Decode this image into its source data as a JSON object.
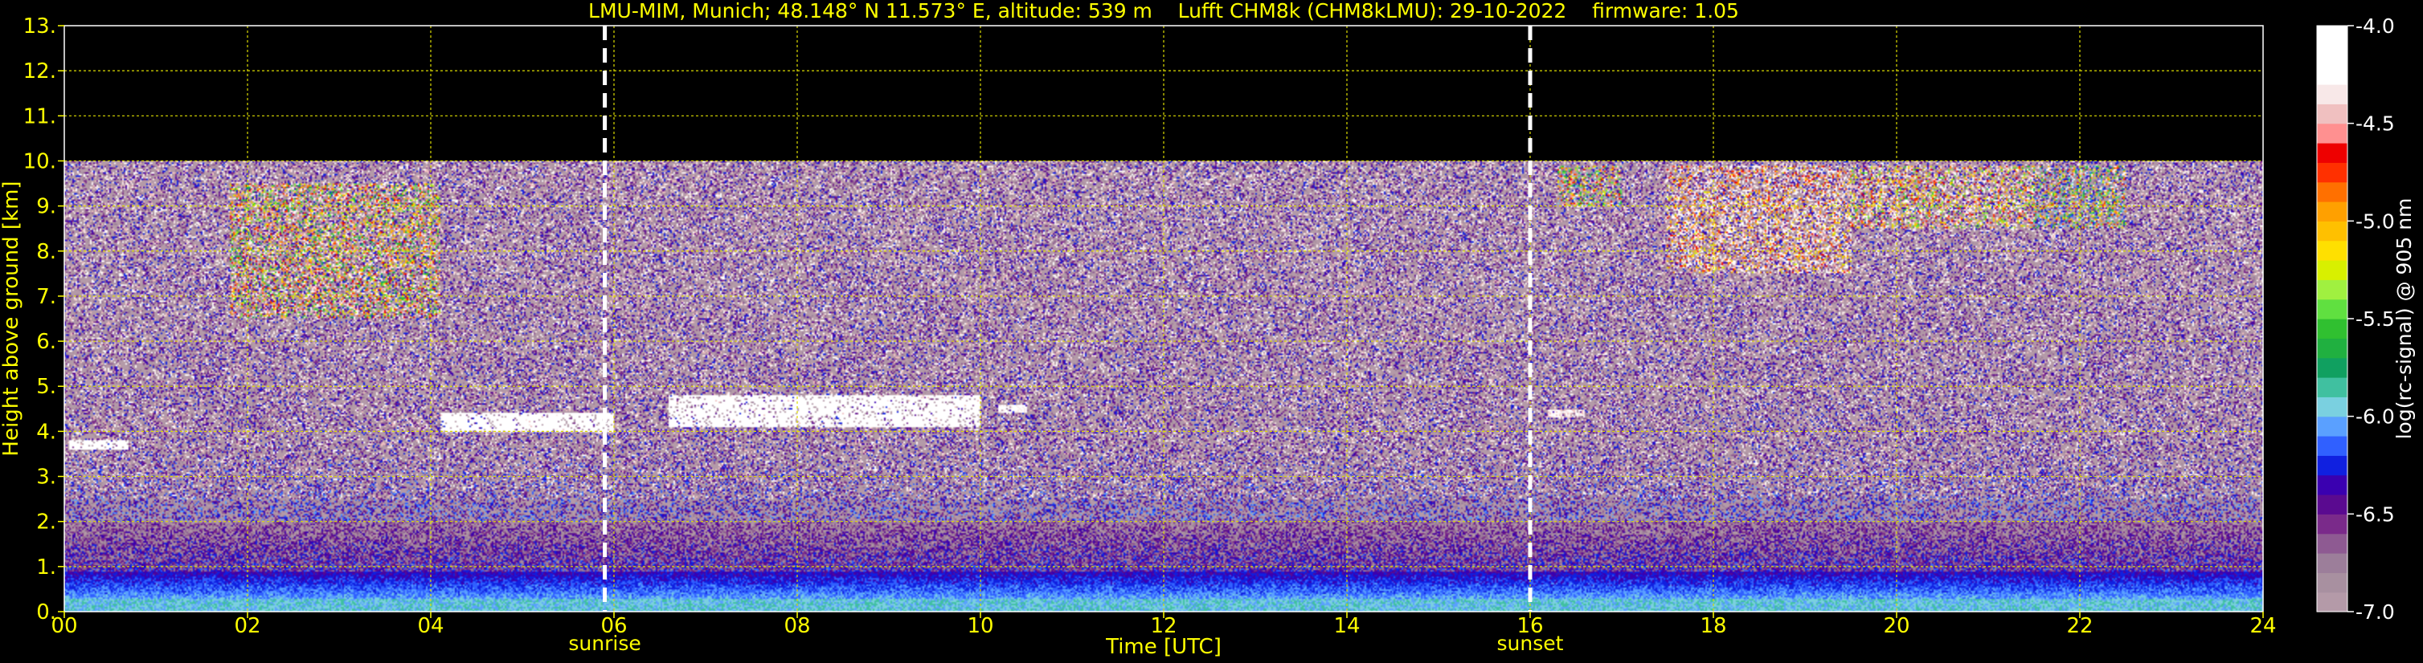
{
  "chart_data": {
    "type": "heatmap",
    "title": "LMU-MIM, Munich; 48.148° N 11.573° E, altitude: 539 m    Lufft CHM8k (CHM8kLMU): 29-10-2022    firmware: 1.05",
    "xlabel": "Time [UTC]",
    "ylabel": "Height above ground [km]",
    "xlim": [
      0,
      24
    ],
    "ylim": [
      0,
      13
    ],
    "x_tick_labels": [
      "00",
      "02",
      "04",
      "06",
      "08",
      "10",
      "12",
      "14",
      "16",
      "18",
      "20",
      "22",
      "24"
    ],
    "y_tick_labels": [
      "0.",
      "1.",
      "2.",
      "3.",
      "4.",
      "5.",
      "6.",
      "7.",
      "8.",
      "9.",
      "10.",
      "11.",
      "12.",
      "13."
    ],
    "grid": true,
    "data_ceiling_km": 10,
    "markers": [
      {
        "label": "sunrise",
        "x": 5.9
      },
      {
        "label": "sunset",
        "x": 16.0
      }
    ],
    "colorbar": {
      "label": "log(rc-signal) @ 905 nm",
      "range": [
        -7.0,
        -4.0
      ],
      "tick_labels": [
        "-4.0",
        "-4.5",
        "-5.0",
        "-5.5",
        "-6.0",
        "-6.5",
        "-7.0"
      ],
      "colors": [
        "#b49aa8",
        "#a890a0",
        "#9c7e9a",
        "#8e5a92",
        "#7a2a8a",
        "#5a0a90",
        "#3a00b0",
        "#1020e0",
        "#3060ff",
        "#5aa0ff",
        "#7ad0e0",
        "#40c0a0",
        "#10a060",
        "#20b040",
        "#30c030",
        "#60e040",
        "#a0f040",
        "#d8f000",
        "#ffe000",
        "#ffc000",
        "#ffa000",
        "#ff7000",
        "#ff3000",
        "#ee0000",
        "#ff9090",
        "#f0c0c0",
        "#f8e8e8",
        "#ffffff",
        "#ffffff",
        "#ffffff"
      ]
    },
    "features": [
      {
        "kind": "cirrus",
        "x": [
          1.8,
          4.1
        ],
        "y": [
          6.5,
          9.5
        ],
        "intensity": -5.0
      },
      {
        "kind": "cloud_layer",
        "x": [
          0.05,
          0.7
        ],
        "y": [
          3.6,
          3.8
        ],
        "intensity": -4.0
      },
      {
        "kind": "cloud_layer",
        "x": [
          4.1,
          6.0
        ],
        "y": [
          4.0,
          4.4
        ],
        "intensity": -4.0
      },
      {
        "kind": "cloud_layer",
        "x": [
          6.6,
          10.0
        ],
        "y": [
          4.1,
          4.8
        ],
        "intensity": -4.0
      },
      {
        "kind": "cloud_layer",
        "x": [
          10.2,
          10.5
        ],
        "y": [
          4.4,
          4.6
        ],
        "intensity": -4.2
      },
      {
        "kind": "cloud_layer",
        "x": [
          16.2,
          16.6
        ],
        "y": [
          4.3,
          4.5
        ],
        "intensity": -4.3
      },
      {
        "kind": "cirrus",
        "x": [
          16.3,
          17.0
        ],
        "y": [
          9.0,
          9.9
        ],
        "intensity": -5.3
      },
      {
        "kind": "cirrus",
        "x": [
          17.5,
          19.5
        ],
        "y": [
          7.5,
          9.9
        ],
        "intensity": -4.5
      },
      {
        "kind": "cirrus",
        "x": [
          19.5,
          21.5
        ],
        "y": [
          8.5,
          9.9
        ],
        "intensity": -4.8
      },
      {
        "kind": "cirrus",
        "x": [
          21.5,
          22.5
        ],
        "y": [
          8.5,
          9.9
        ],
        "intensity": -5.5
      }
    ]
  }
}
